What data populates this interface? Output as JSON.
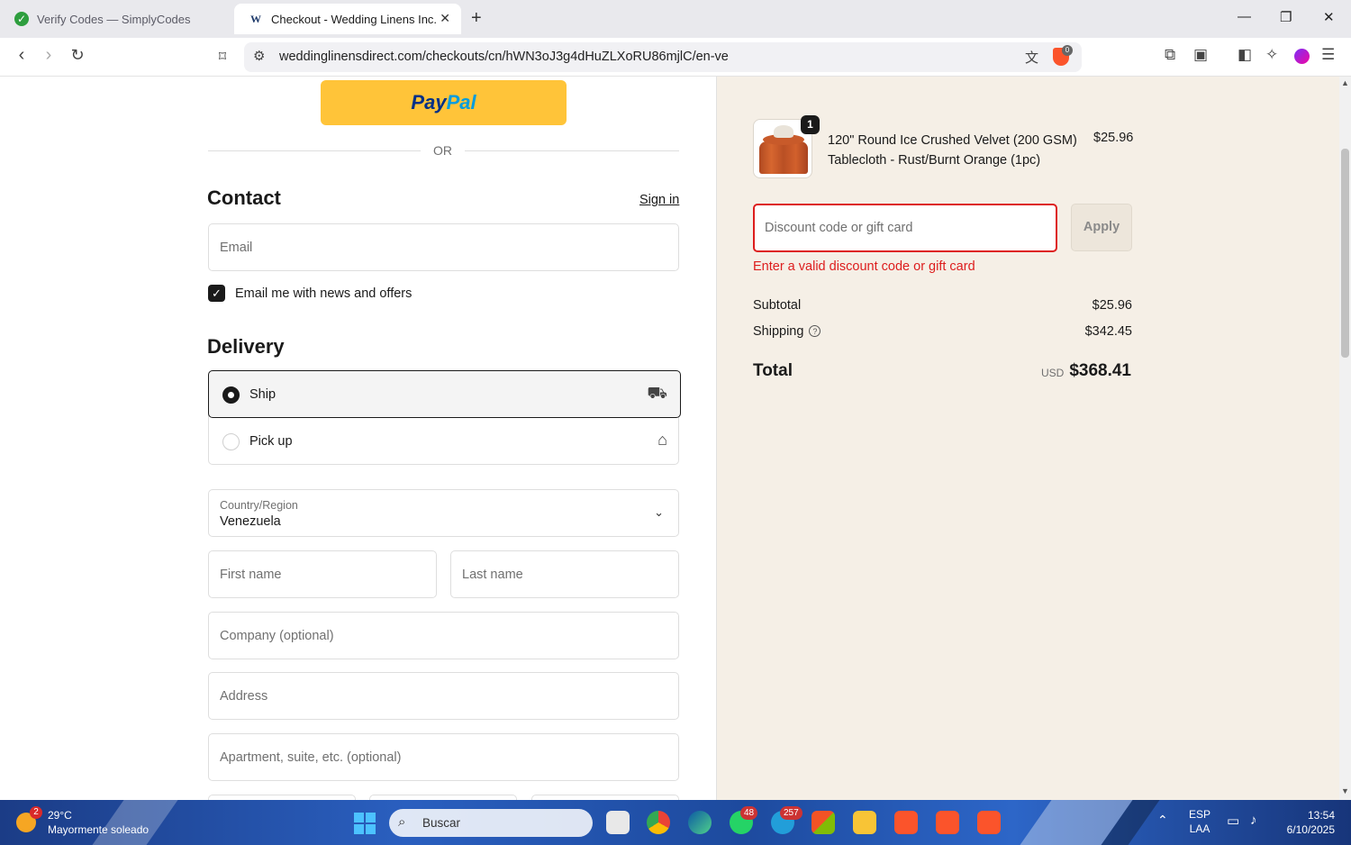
{
  "browser": {
    "tabs": [
      {
        "title": "Verify Codes — SimplyCodes",
        "active": false
      },
      {
        "title": "Checkout - Wedding Linens Inc.",
        "active": true
      }
    ],
    "url": "weddinglinensdirect.com/checkouts/cn/hWN3oJ3g4dHuZLXoRU86mjlC/en-ve",
    "shield_count": "0"
  },
  "checkout": {
    "paypal": {
      "part1": "Pay",
      "part2": "Pal"
    },
    "or_text": "OR",
    "contact": {
      "heading": "Contact",
      "signin_label": "Sign in",
      "email_placeholder": "Email",
      "newsletter_label": "Email me with news and offers",
      "newsletter_checked": true
    },
    "delivery": {
      "heading": "Delivery",
      "options": [
        {
          "label": "Ship",
          "selected": true,
          "icon": "truck-icon"
        },
        {
          "label": "Pick up",
          "selected": false,
          "icon": "store-icon"
        }
      ],
      "country_label": "Country/Region",
      "country_value": "Venezuela",
      "first_name_placeholder": "First name",
      "last_name_placeholder": "Last name",
      "company_placeholder": "Company (optional)",
      "address_placeholder": "Address",
      "apartment_placeholder": "Apartment, suite, etc. (optional)"
    }
  },
  "summary": {
    "item": {
      "quantity": "1",
      "name": "120\" Round Ice Crushed Velvet (200 GSM) Tablecloth - Rust/Burnt Orange (1pc)",
      "price": "$25.96"
    },
    "discount_placeholder": "Discount code or gift card",
    "apply_label": "Apply",
    "discount_error": "Enter a valid discount code or gift card",
    "subtotal_label": "Subtotal",
    "subtotal_value": "$25.96",
    "shipping_label": "Shipping",
    "shipping_value": "$342.45",
    "total_label": "Total",
    "total_currency": "USD",
    "total_value": "$368.41"
  },
  "taskbar": {
    "weather_alerts": "2",
    "weather_temp": "29°C",
    "weather_desc": "Mayormente soleado",
    "search_label": "Buscar",
    "whatsapp_badge": "48",
    "telegram_badge": "257",
    "lang_line1": "ESP",
    "lang_line2": "LAA",
    "time": "13:54",
    "date": "6/10/2025"
  },
  "colors": {
    "error": "#dd1d1d",
    "summary_bg": "#f5efe6",
    "paypal": "#ffc439"
  }
}
